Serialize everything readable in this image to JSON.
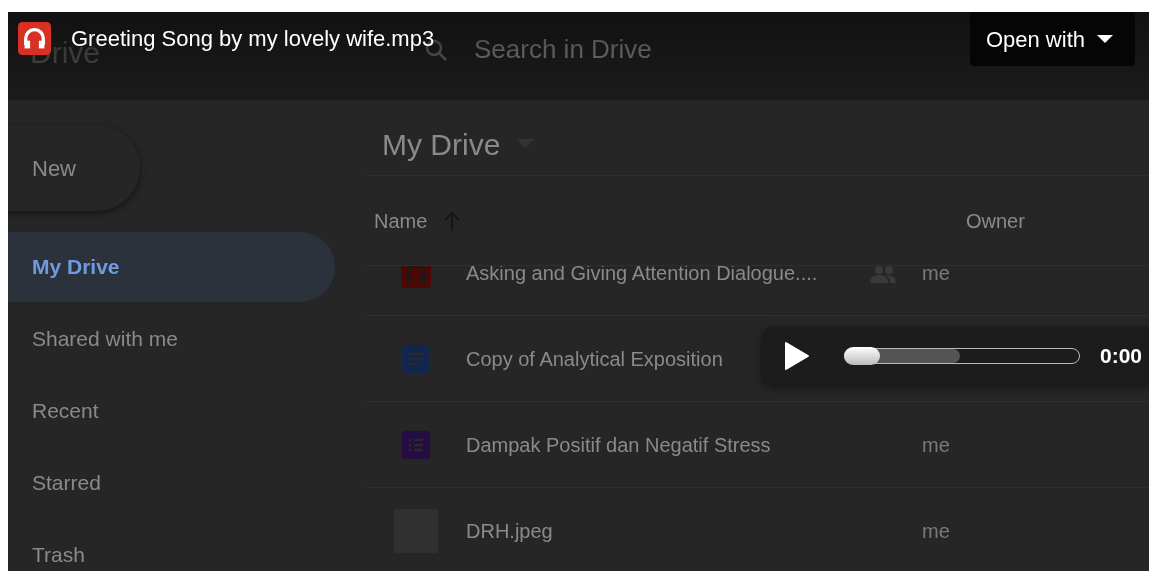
{
  "viewer": {
    "file_name": "Greeting Song by my lovely wife.mp3",
    "open_with": "Open with"
  },
  "drive": {
    "logo": "Drive",
    "search": {
      "placeholder": "Search in Drive"
    },
    "new_button": "New",
    "sidebar": {
      "items": [
        {
          "label": "My Drive",
          "selected": true
        },
        {
          "label": "Shared with me",
          "selected": false
        },
        {
          "label": "Recent",
          "selected": false
        },
        {
          "label": "Starred",
          "selected": false
        },
        {
          "label": "Trash",
          "selected": false
        }
      ]
    },
    "breadcrumb": "My Drive",
    "columns": [
      {
        "label": "Name",
        "sorted": true
      },
      {
        "label": "Owner",
        "sorted": false
      }
    ],
    "files": [
      {
        "kind": "audio",
        "name": "Asking and Giving Attention Dialogue....",
        "shared": true,
        "owner": "me"
      },
      {
        "kind": "doc",
        "name": "Copy of Analytical Exposition",
        "shared": false
      },
      {
        "kind": "form",
        "name": "Dampak Positif dan Negatif Stress",
        "shared": false,
        "owner": "me"
      },
      {
        "kind": "image",
        "name": "DRH.jpeg",
        "shared": false,
        "owner": "me"
      }
    ]
  },
  "player": {
    "progress": {
      "level": 0
    },
    "buffer": {
      "level": 0.49
    },
    "time": "0:00"
  }
}
